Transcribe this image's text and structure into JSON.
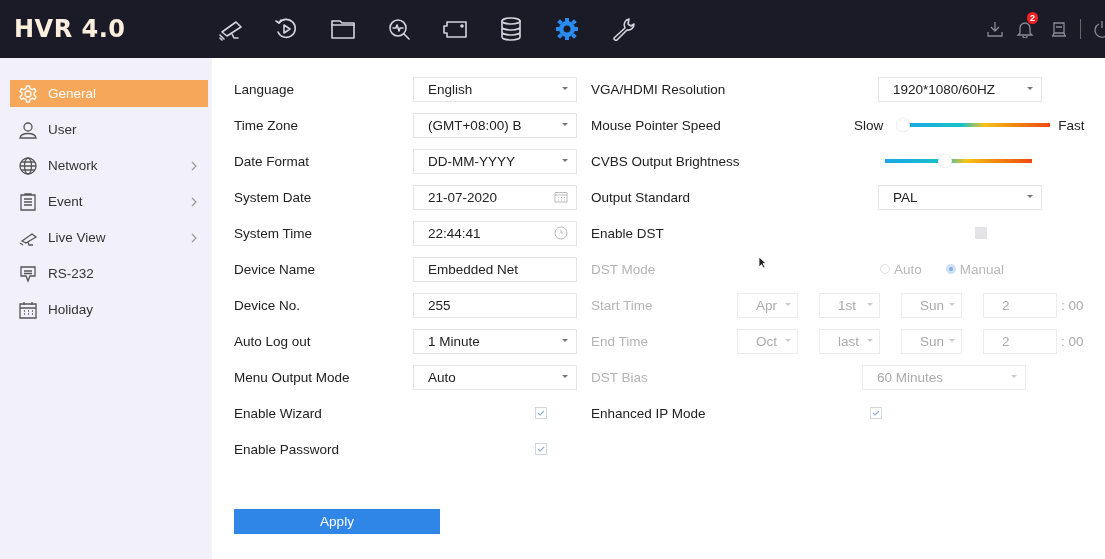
{
  "header": {
    "logo": "HVR 4.0",
    "tabs": [
      {
        "kind": "camera",
        "selected": false
      },
      {
        "kind": "playback",
        "selected": false
      },
      {
        "kind": "folder",
        "selected": false
      },
      {
        "kind": "search",
        "selected": false
      },
      {
        "kind": "screen",
        "selected": false
      },
      {
        "kind": "storage",
        "selected": false
      },
      {
        "kind": "gear",
        "selected": true
      },
      {
        "kind": "wrench",
        "selected": false
      }
    ],
    "tools": [
      {
        "kind": "download"
      },
      {
        "kind": "bell",
        "badge": "2"
      },
      {
        "kind": "monitor"
      },
      {
        "kind": "power"
      }
    ]
  },
  "sidebar": {
    "items": [
      {
        "kind": "gear",
        "label": "General",
        "selected": true,
        "has_submenu": false
      },
      {
        "kind": "user",
        "label": "User",
        "selected": false,
        "has_submenu": false
      },
      {
        "kind": "globe",
        "label": "Network",
        "selected": false,
        "has_submenu": true
      },
      {
        "kind": "clipboard",
        "label": "Event",
        "selected": false,
        "has_submenu": true
      },
      {
        "kind": "camera",
        "label": "Live View",
        "selected": false,
        "has_submenu": true
      },
      {
        "kind": "chat",
        "label": "RS-232",
        "selected": false,
        "has_submenu": false
      },
      {
        "kind": "calendar",
        "label": "Holiday",
        "selected": false,
        "has_submenu": false
      }
    ]
  },
  "left_settings": [
    {
      "kind": "select",
      "label": "Language",
      "value": "English"
    },
    {
      "kind": "select",
      "label": "Time Zone",
      "value": "(GMT+08:00) B"
    },
    {
      "kind": "select",
      "label": "Date Format",
      "value": "DD-MM-YYYY"
    },
    {
      "kind": "date",
      "label": "System Date",
      "value": "21-07-2020"
    },
    {
      "kind": "time",
      "label": "System Time",
      "value": "22:44:41"
    },
    {
      "kind": "text",
      "label": "Device Name",
      "value": "Embedded Net"
    },
    {
      "kind": "text",
      "label": "Device No.",
      "value": "255"
    },
    {
      "kind": "select",
      "label": "Auto Log out",
      "value": "1 Minute"
    },
    {
      "kind": "select",
      "label": "Menu Output Mode",
      "value": "Auto"
    },
    {
      "kind": "checkbox",
      "label": "Enable Wizard",
      "checked": true
    },
    {
      "kind": "checkbox",
      "label": "Enable Password",
      "checked": true
    }
  ],
  "right_settings": [
    {
      "kind": "select",
      "label": "VGA/HDMI Resolution",
      "value": "1920*1080/60HZ",
      "disabled": false
    },
    {
      "kind": "slider",
      "label": "Mouse Pointer Speed",
      "min_label": "Slow",
      "max_label": "Fast",
      "level": 0,
      "disabled": false
    },
    {
      "kind": "slider",
      "label": "CVBS Output Brightness",
      "level": 0.43,
      "disabled": false
    },
    {
      "kind": "select",
      "label": "Output Standard",
      "value": "PAL",
      "disabled": false
    },
    {
      "kind": "checkbox",
      "label": "Enable DST",
      "checked": false,
      "disabled": false
    },
    {
      "kind": "radio",
      "label": "DST Mode",
      "disabled": true,
      "options": [
        {
          "label": "Auto",
          "selected": false
        },
        {
          "label": "Manual",
          "selected": true
        }
      ]
    },
    {
      "kind": "time_rule",
      "label": "Start Time",
      "disabled": true,
      "parts": [
        "Apr",
        "1st",
        "Sun",
        "2"
      ],
      "suffix": ": 00"
    },
    {
      "kind": "time_rule",
      "label": "End Time",
      "disabled": true,
      "parts": [
        "Oct",
        "last",
        "Sun",
        "2"
      ],
      "suffix": ": 00"
    },
    {
      "kind": "select",
      "label": "DST Bias",
      "value": "60 Minutes",
      "disabled": true
    },
    {
      "kind": "checkbox",
      "label": "Enhanced IP Mode",
      "checked": true,
      "disabled": false
    }
  ],
  "apply_button": "Apply"
}
